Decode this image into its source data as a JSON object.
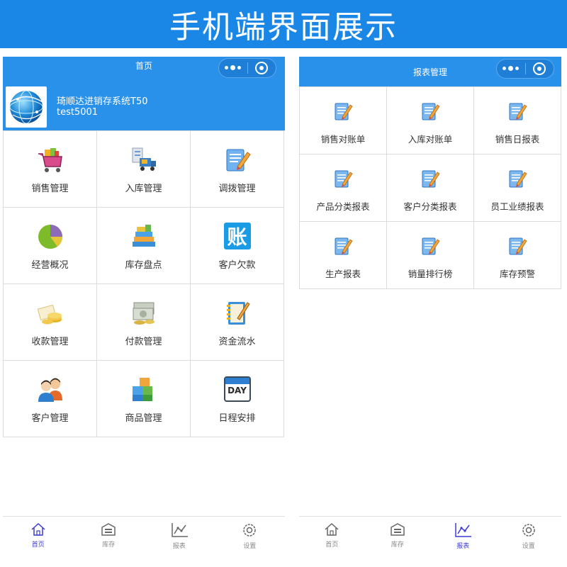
{
  "banner": {
    "title": "手机端界面展示"
  },
  "left_screen": {
    "nav_title": "首页",
    "company": "琦顺达进销存系统T50",
    "user": "test5001",
    "menu": [
      {
        "label": "销售管理",
        "icon": "shopping-cart-icon"
      },
      {
        "label": "入库管理",
        "icon": "warehouse-truck-icon"
      },
      {
        "label": "调拨管理",
        "icon": "edit-document-icon"
      },
      {
        "label": "经营概况",
        "icon": "pie-chart-icon"
      },
      {
        "label": "库存盘点",
        "icon": "stacked-books-icon"
      },
      {
        "label": "客户欠款",
        "icon": "ledger-icon"
      },
      {
        "label": "收款管理",
        "icon": "coins-icon"
      },
      {
        "label": "付款管理",
        "icon": "cash-icon"
      },
      {
        "label": "资金流水",
        "icon": "notepad-pencil-icon"
      },
      {
        "label": "客户管理",
        "icon": "customers-icon"
      },
      {
        "label": "商品管理",
        "icon": "product-boxes-icon"
      },
      {
        "label": "日程安排",
        "icon": "day-calendar-icon"
      }
    ],
    "tabs": [
      {
        "label": "首页",
        "icon": "home-icon",
        "active": true
      },
      {
        "label": "库存",
        "icon": "warehouse-icon",
        "active": false
      },
      {
        "label": "报表",
        "icon": "report-chart-icon",
        "active": false
      },
      {
        "label": "设置",
        "icon": "settings-icon",
        "active": false
      }
    ],
    "ledger_glyph": "账",
    "calendar_glyph": "DAY"
  },
  "right_screen": {
    "nav_title": "报表管理",
    "reports": [
      {
        "label": "销售对账单",
        "icon": "report-edit-icon"
      },
      {
        "label": "入库对账单",
        "icon": "report-edit-icon"
      },
      {
        "label": "销售日报表",
        "icon": "report-edit-icon"
      },
      {
        "label": "产品分类报表",
        "icon": "report-edit-icon"
      },
      {
        "label": "客户分类报表",
        "icon": "report-edit-icon"
      },
      {
        "label": "员工业绩报表",
        "icon": "report-edit-icon"
      },
      {
        "label": "生产报表",
        "icon": "report-edit-icon"
      },
      {
        "label": "销量排行榜",
        "icon": "report-edit-icon"
      },
      {
        "label": "库存预警",
        "icon": "report-edit-icon"
      }
    ],
    "tabs": [
      {
        "label": "首页",
        "icon": "home-icon",
        "active": false
      },
      {
        "label": "库存",
        "icon": "warehouse-icon",
        "active": false
      },
      {
        "label": "报表",
        "icon": "report-chart-icon",
        "active": true
      },
      {
        "label": "设置",
        "icon": "settings-icon",
        "active": false
      }
    ]
  },
  "colors": {
    "banner": "#1a86e6",
    "header": "#2a91ea",
    "tab_active": "#3b3bd1",
    "tab_inactive": "#888888"
  }
}
